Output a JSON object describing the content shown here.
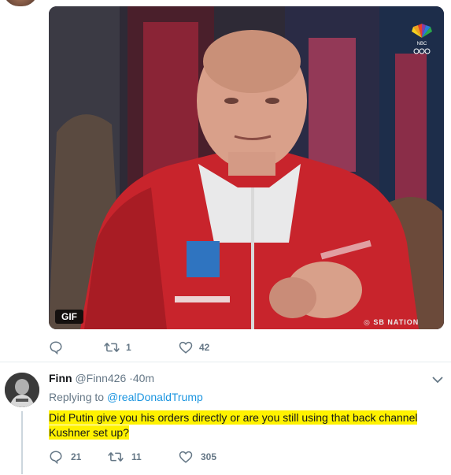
{
  "media": {
    "gif_label": "GIF",
    "watermark": "SB NATION",
    "broadcaster": "NBC"
  },
  "tweet_actions": {
    "reply_count": "",
    "retweet_count": "1",
    "like_count": "42"
  },
  "reply": {
    "name": "Finn",
    "handle": "@Finn426",
    "separator": "·",
    "time": "40m",
    "replying_prefix": "Replying to",
    "replying_handle": "@realDonaldTrump",
    "text_line1": "Did Putin give you his orders directly or are you still using that back channel",
    "text_line2": "Kushner set up?",
    "reply_count": "21",
    "retweet_count": "11",
    "like_count": "305"
  },
  "colors": {
    "meta_gray": "#657786",
    "link_blue": "#1b95e0",
    "highlight": "#fff200",
    "divider": "#e6ecf0"
  },
  "icons": [
    "reply-icon",
    "retweet-icon",
    "heart-icon",
    "chevron-down-icon"
  ]
}
